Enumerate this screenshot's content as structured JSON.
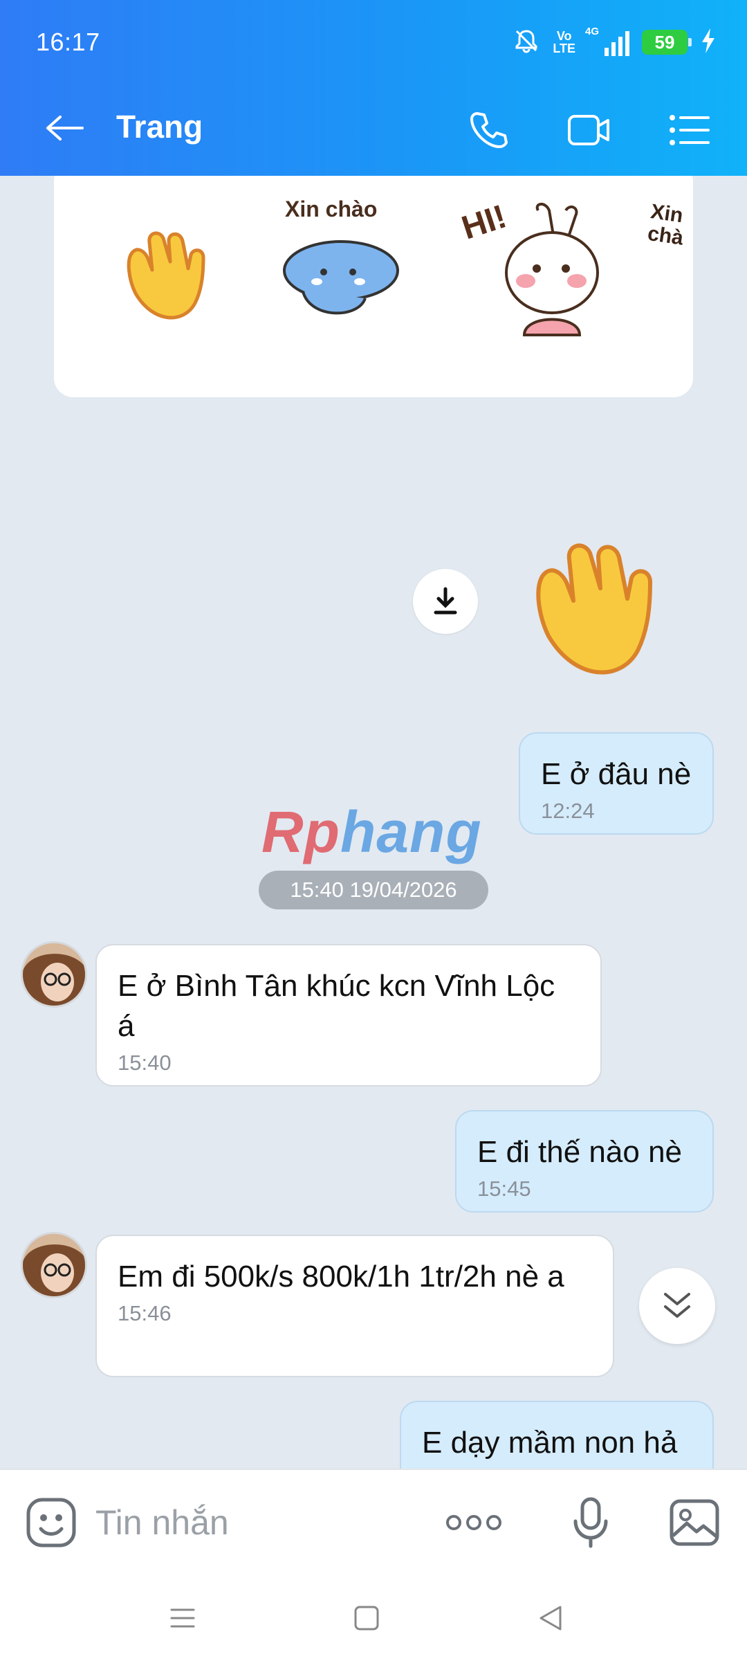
{
  "status_bar": {
    "time": "16:17",
    "volte_top": "Vo",
    "volte_bottom": "LTE",
    "network": "4G",
    "battery": "59"
  },
  "header": {
    "title": "Trang",
    "icons": [
      "back-arrow-icon",
      "phone-icon",
      "video-call-icon",
      "list-menu-icon"
    ]
  },
  "sticker_suggestions": {
    "stickers": [
      {
        "name": "waving-hand-sticker"
      },
      {
        "name": "cat-xin-chao-sticker",
        "caption": "Xin chào"
      },
      {
        "name": "bunny-hi-sticker",
        "caption": "HI!"
      },
      {
        "name": "partial-xin-chao-sticker",
        "caption": "Xin chà"
      }
    ]
  },
  "messages": [
    {
      "from": "me",
      "type": "sticker",
      "sticker": "waving-hand"
    },
    {
      "from": "me",
      "text": "E ở đâu nè",
      "time": "12:24"
    },
    {
      "from": "them",
      "text": "E ở Bình Tân khúc kcn Vĩnh Lộc á",
      "time": "15:40"
    },
    {
      "from": "me",
      "text": "E đi thế nào nè",
      "time": "15:45"
    },
    {
      "from": "them",
      "text": "Em đi 500k/s 800k/1h 1tr/2h nè a",
      "time": "15:46"
    },
    {
      "from": "me",
      "text": "E dạy mầm non hả",
      "time": ""
    }
  ],
  "watermark": {
    "part1": "Rp",
    "part2": "hang"
  },
  "date_separator": "15:40 19/04/2026",
  "input": {
    "placeholder": "Tin nhắn"
  },
  "colors": {
    "header_start": "#2f7cf6",
    "header_end": "#10b2f9",
    "my_bubble": "#d5ecfc",
    "their_bubble": "#ffffff",
    "chat_bg": "#e2e9f1"
  }
}
